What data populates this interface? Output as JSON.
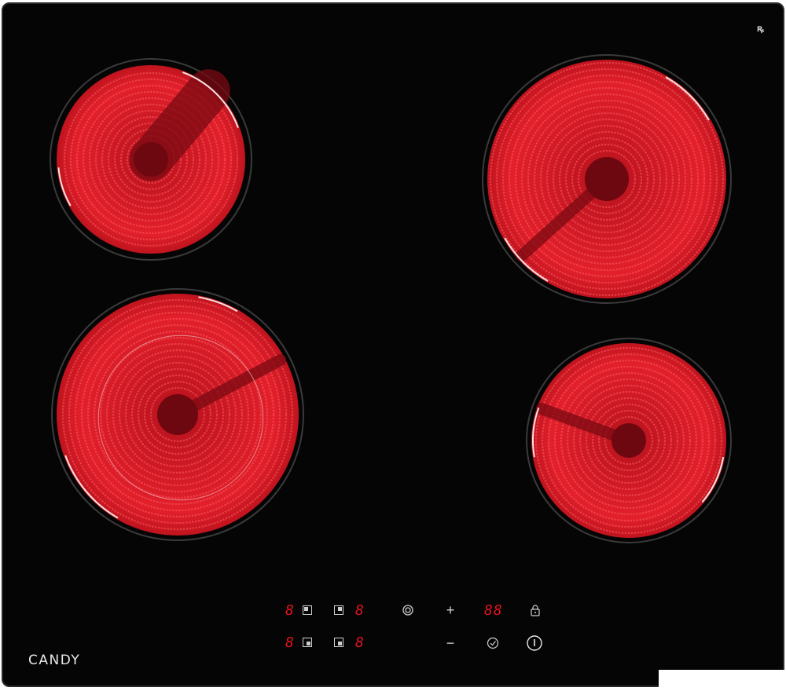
{
  "brand": "CANDY",
  "corner_mark": "ꝶ",
  "zones": [
    {
      "id": "rear-left",
      "color": "#e2202b"
    },
    {
      "id": "front-left-dual",
      "color": "#e2202b"
    },
    {
      "id": "rear-right",
      "color": "#e2202b"
    },
    {
      "id": "front-right",
      "color": "#e2202b"
    }
  ],
  "controls": {
    "zone_displays": [
      "8",
      "8",
      "8",
      "8"
    ],
    "plus": "+",
    "minus": "−",
    "timer_display": "88",
    "lock_icon": "lock-icon",
    "dual_ring_icon": "dual-ring-icon",
    "timer_icon": "timer-check-icon",
    "power_icon": "power-icon"
  },
  "colors": {
    "glass": "#050505",
    "heating": "#e2202b",
    "display": "#e0141e",
    "marking": "#cfcfcf"
  }
}
